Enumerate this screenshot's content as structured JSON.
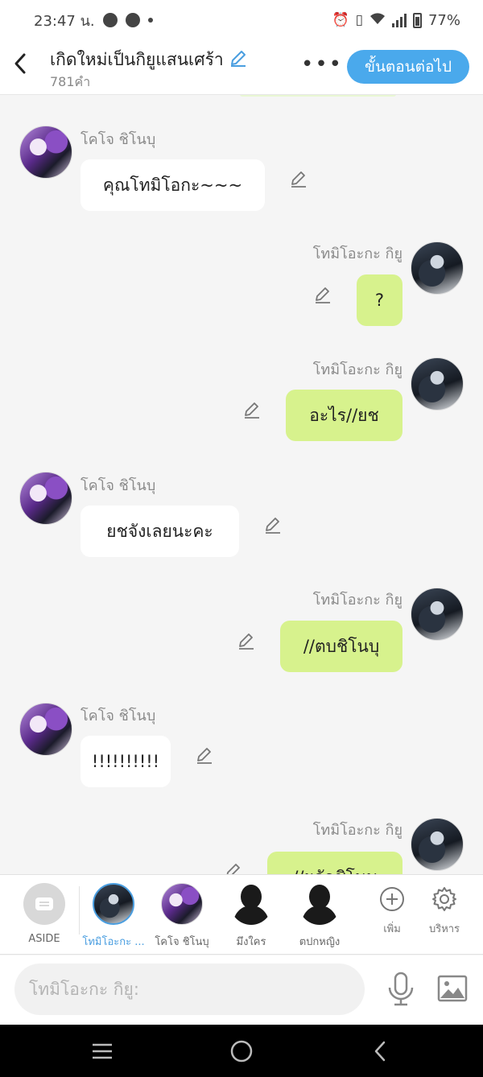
{
  "status": {
    "time": "23:47 น.",
    "battery": "77%"
  },
  "header": {
    "back": "<",
    "title": "เกิดใหม่เป็นกิยูแสนเศร้า",
    "word_count": "781คำ",
    "more": "•••",
    "next_button": "ขั้นตอนต่อไป"
  },
  "messages": [
    {
      "sender": "โคโจ ชิโนบุ",
      "text": "คุณโทมิโอกะ~~~",
      "side": "left"
    },
    {
      "sender": "โทมิโอะกะ กิยู",
      "text": "?",
      "side": "right"
    },
    {
      "sender": "โทมิโอะกะ กิยู",
      "text": "อะไร//ยช",
      "side": "right"
    },
    {
      "sender": "โคโจ ชิโนบุ",
      "text": "ยชจังเลยนะคะ",
      "side": "left"
    },
    {
      "sender": "โทมิโอะกะ กิยู",
      "text": "//ตบชิโนบุ",
      "side": "right"
    },
    {
      "sender": "โคโจ ชิโนบุ",
      "text": "!!!!!!!!!!",
      "side": "left"
    },
    {
      "sender": "โทมิโอะกะ กิยู",
      "text": "//ผลักชิโนบุ",
      "side": "right"
    }
  ],
  "characters": [
    {
      "label": "ASIDE",
      "icon": "aside-icon"
    },
    {
      "label": "โทมิโอะกะ ...",
      "icon": "giyu-avatar",
      "active": true
    },
    {
      "label": "โคโจ ชิโนบุ",
      "icon": "shinobu-avatar"
    },
    {
      "label": "มึงใคร",
      "icon": "silhouette-avatar"
    },
    {
      "label": "ตปกหญิง",
      "icon": "silhouette-avatar"
    }
  ],
  "tools": {
    "add_label": "เพิ่ม",
    "manage_label": "บริหาร"
  },
  "input": {
    "placeholder": "โทมิโอะกะ กิยู:"
  },
  "colors": {
    "accent": "#4aa9ec",
    "bubble_right": "#d7f28d",
    "bubble_left": "#ffffff",
    "background": "#f5f5f5"
  }
}
